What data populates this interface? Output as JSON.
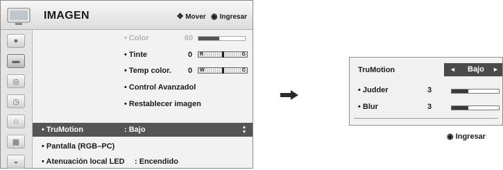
{
  "menu": {
    "title": "IMAGEN",
    "hints": [
      {
        "icon": "move-arrows-icon",
        "glyph": "✥",
        "label": "Mover"
      },
      {
        "icon": "ok-button-icon",
        "glyph": "◉",
        "label": "Ingresar"
      }
    ],
    "sidebar_icons": [
      "picture-icon",
      "screen-icon",
      "audio-icon",
      "clock-icon",
      "lock-icon",
      "option-icon",
      "network-icon"
    ],
    "active_sidebar_index": 1,
    "rows": [
      {
        "label": "• Color",
        "value": "60",
        "bar_fraction": 0.45,
        "dimmed": true
      },
      {
        "label": "• Tinte",
        "value": "0",
        "left": "R",
        "right": "G",
        "mark_fraction": 0.5
      },
      {
        "label": "• Temp color.",
        "value": "0",
        "left": "W",
        "right": "C",
        "mark_fraction": 0.5
      },
      {
        "label": "• Control Avanzadol"
      },
      {
        "label": "• Restablecer imagen"
      },
      {
        "label": "• TruMotion",
        "value": ": Bajo",
        "selected": true
      },
      {
        "label": "• Pantalla (RGB–PC)"
      },
      {
        "label": "• Atenuación local LED",
        "value": ": Encendido"
      }
    ]
  },
  "popup": {
    "title": "TruMotion",
    "selected_value": "Bajo",
    "left_arrow": "◄",
    "right_arrow": "►",
    "items": [
      {
        "label": "• Judder",
        "value": "3",
        "bar_fraction": 0.35
      },
      {
        "label": "• Blur",
        "value": "3",
        "bar_fraction": 0.35
      }
    ],
    "confirm_glyph": "◉",
    "confirm_label": "Ingresar"
  },
  "colors": {
    "highlight": "#555555",
    "selector": "#4a4a4a",
    "bar_fill": "#3b3b3b"
  }
}
